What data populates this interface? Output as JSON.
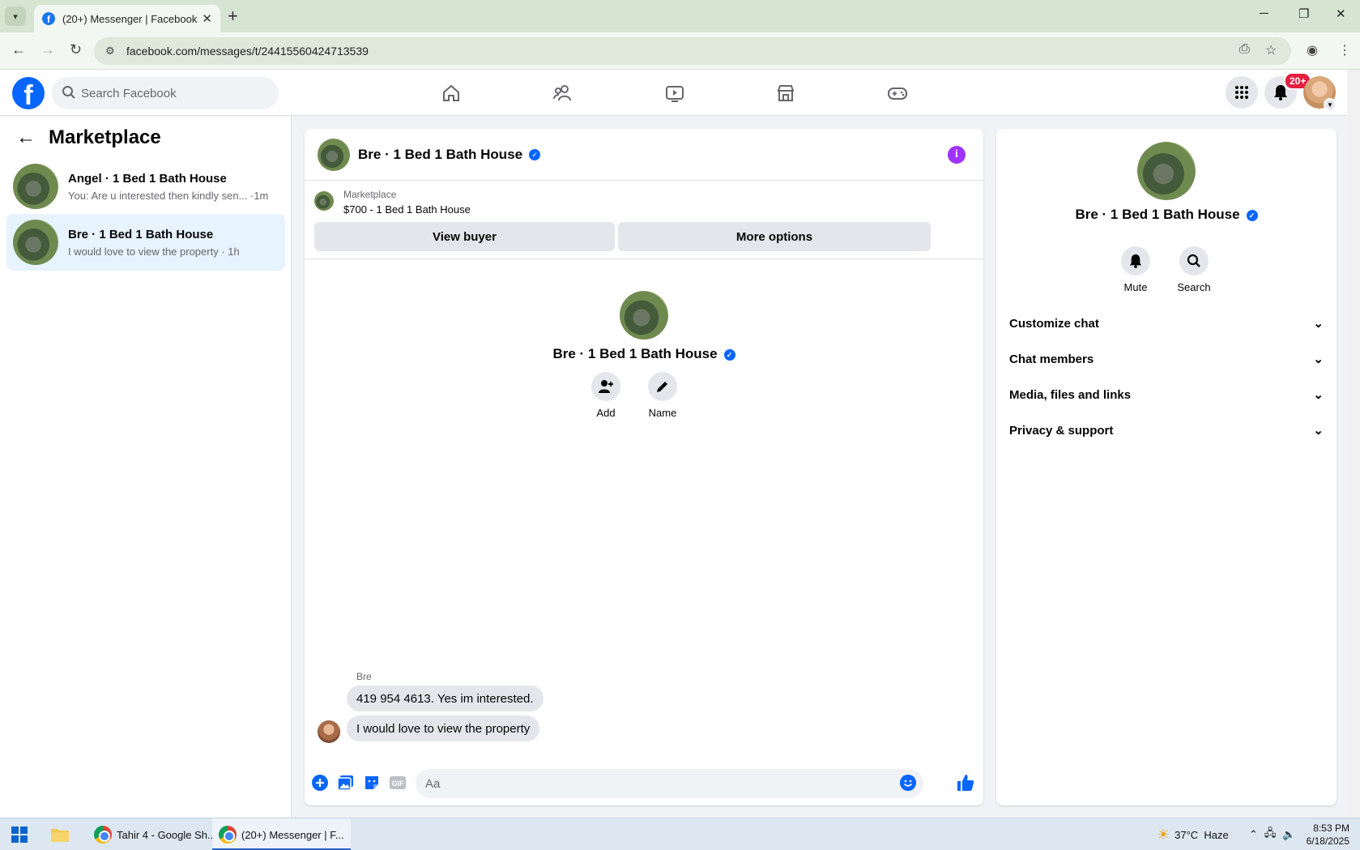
{
  "browser": {
    "tab_title": "(20+) Messenger | Facebook",
    "tab_close": "✕",
    "new_tab": "+",
    "url": "facebook.com/messages/t/24415560424713539"
  },
  "fb_header": {
    "logo": "f",
    "search_placeholder": "Search Facebook",
    "notification_badge": "20+"
  },
  "left_panel": {
    "title": "Marketplace",
    "conversations": [
      {
        "name": "Angel · 1 Bed 1 Bath House",
        "snippet": "You: Are u interested then kindly sen... ·1m"
      },
      {
        "name": "Bre · 1 Bed 1 Bath House",
        "snippet": "I would love to view the property · 1h"
      }
    ]
  },
  "chat": {
    "title": "Bre · 1 Bed 1 Bath House",
    "info_label": "i",
    "marketplace_label": "Marketplace",
    "listing": "$700 - 1 Bed 1 Bath House",
    "view_buyer": "View buyer",
    "more_options": "More options",
    "profile_name": "Bre · 1 Bed 1 Bath House",
    "add_label": "Add",
    "name_label": "Name",
    "sender": "Bre",
    "messages": [
      "419 954 4613. Yes im interested.",
      "I would love to view the property"
    ],
    "composer_placeholder": "Aa"
  },
  "right_panel": {
    "name": "Bre · 1 Bed 1 Bath House",
    "mute_label": "Mute",
    "search_label": "Search",
    "sections": [
      "Customize chat",
      "Chat members",
      "Media, files and links",
      "Privacy & support"
    ]
  },
  "taskbar": {
    "item1": "Tahir 4 - Google Sh...",
    "item2": "(20+) Messenger | F...",
    "weather": "37°C  Haze",
    "time": "8:53 PM",
    "date": "6/18/2025"
  },
  "colors": {
    "accent": "#0866ff",
    "info": "#a033ff",
    "badge": "#e41e3f",
    "active_convo": "#e7f3ff"
  }
}
